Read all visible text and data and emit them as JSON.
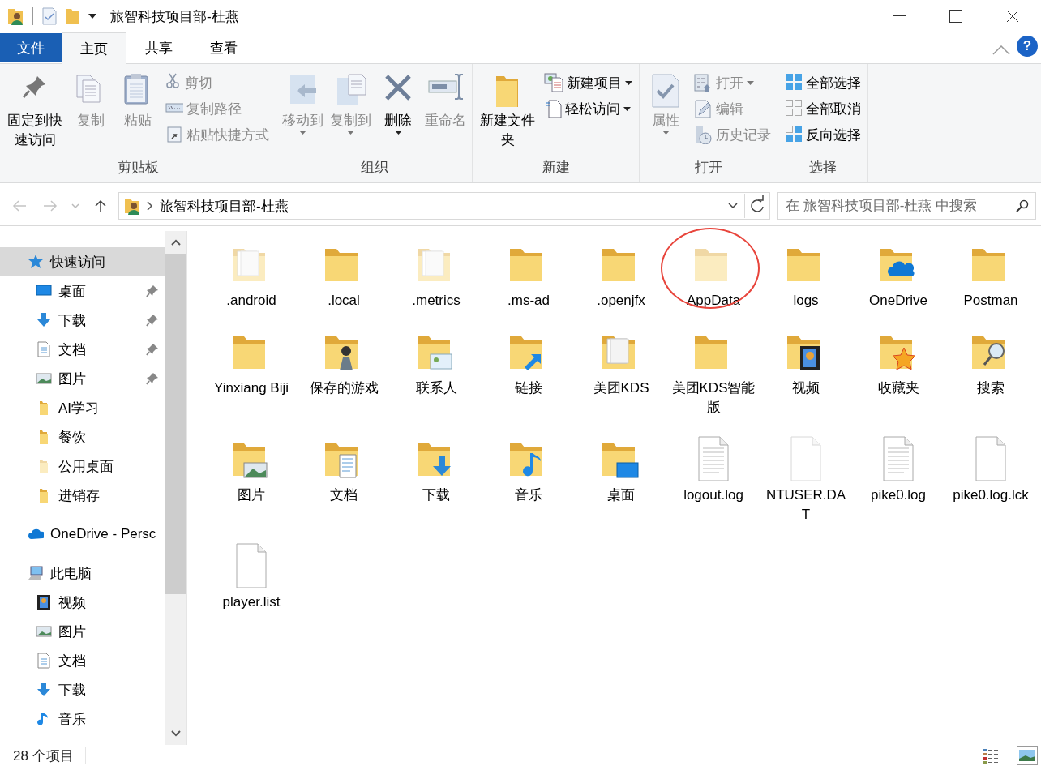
{
  "window": {
    "title": "旅智科技项目部-杜燕",
    "help": "?"
  },
  "ribbon_tabs": [
    {
      "label": "文件",
      "kind": "file",
      "selected": false
    },
    {
      "label": "主页",
      "kind": "tab",
      "selected": true
    },
    {
      "label": "共享",
      "kind": "tab",
      "selected": false
    },
    {
      "label": "查看",
      "kind": "tab",
      "selected": false
    }
  ],
  "ribbon_groups": [
    {
      "label": "剪贴板",
      "large": [
        {
          "label": "固定到快速访问",
          "kind": "pin",
          "disabled": false,
          "dropdown": false
        },
        {
          "label": "复制",
          "kind": "copy",
          "disabled": true,
          "dropdown": false
        },
        {
          "label": "粘贴",
          "kind": "paste",
          "disabled": true,
          "dropdown": false
        }
      ],
      "small": [
        {
          "label": "剪切",
          "kind": "cut",
          "disabled": true,
          "dropdown": false
        },
        {
          "label": "复制路径",
          "kind": "path",
          "disabled": true,
          "dropdown": false
        },
        {
          "label": "粘贴快捷方式",
          "kind": "shortcut",
          "disabled": true,
          "dropdown": false
        }
      ]
    },
    {
      "label": "组织",
      "large": [
        {
          "label": "移动到",
          "kind": "move",
          "disabled": true,
          "dropdown": true
        },
        {
          "label": "复制到",
          "kind": "copyto",
          "disabled": true,
          "dropdown": true
        },
        {
          "label": "删除",
          "kind": "delete",
          "disabled": false,
          "dropdown": true
        },
        {
          "label": "重命名",
          "kind": "rename",
          "disabled": true,
          "dropdown": false
        }
      ]
    },
    {
      "label": "新建",
      "large": [
        {
          "label": "新建文件夹",
          "kind": "newfolder",
          "disabled": false,
          "dropdown": false
        }
      ],
      "small": [
        {
          "label": "新建项目",
          "kind": "newitem",
          "disabled": false,
          "dropdown": true
        },
        {
          "label": "轻松访问",
          "kind": "easy",
          "disabled": false,
          "dropdown": true
        }
      ]
    },
    {
      "label": "打开",
      "large": [
        {
          "label": "属性",
          "kind": "properties",
          "disabled": true,
          "dropdown": true
        }
      ],
      "small": [
        {
          "label": "打开",
          "kind": "open",
          "disabled": true,
          "dropdown": true
        },
        {
          "label": "编辑",
          "kind": "edit",
          "disabled": true,
          "dropdown": false
        },
        {
          "label": "历史记录",
          "kind": "history",
          "disabled": true,
          "dropdown": false
        }
      ]
    },
    {
      "label": "选择",
      "small": [
        {
          "label": "全部选择",
          "kind": "selectall",
          "disabled": false,
          "dropdown": false
        },
        {
          "label": "全部取消",
          "kind": "selectnone",
          "disabled": false,
          "dropdown": false
        },
        {
          "label": "反向选择",
          "kind": "invert",
          "disabled": false,
          "dropdown": false
        }
      ]
    }
  ],
  "navigation": {
    "back": {
      "disabled": true
    },
    "forward": {
      "disabled": true
    }
  },
  "address": {
    "path": "旅智科技项目部-杜燕"
  },
  "search": {
    "placeholder": "在 旅智科技项目部-杜燕 中搜索"
  },
  "sidebar": {
    "items": [
      {
        "label": "快速访问",
        "kind": "star",
        "selected": true,
        "children": [
          {
            "label": "桌面",
            "kind": "desktop",
            "pinned": true,
            "selected": false
          },
          {
            "label": "下载",
            "kind": "downloads",
            "pinned": true,
            "selected": false
          },
          {
            "label": "文档",
            "kind": "documents",
            "pinned": true,
            "selected": false
          },
          {
            "label": "图片",
            "kind": "pictures",
            "pinned": true,
            "selected": false
          },
          {
            "label": "AI学习",
            "kind": "folder",
            "pinned": false,
            "selected": false
          },
          {
            "label": "餐饮",
            "kind": "folder",
            "pinned": false,
            "selected": false
          },
          {
            "label": "公用桌面",
            "kind": "folder",
            "pinned": false,
            "hidden": true,
            "selected": false
          },
          {
            "label": "进销存",
            "kind": "folder",
            "pinned": false,
            "selected": false
          }
        ]
      },
      {
        "label": "OneDrive - Persc",
        "kind": "cloud",
        "selected": false
      },
      {
        "label": "此电脑",
        "kind": "pc",
        "selected": false,
        "children": [
          {
            "label": "视频",
            "kind": "videos",
            "pinned": false,
            "selected": false
          },
          {
            "label": "图片",
            "kind": "pictures",
            "pinned": false,
            "selected": false
          },
          {
            "label": "文档",
            "kind": "documents",
            "pinned": false,
            "selected": false
          },
          {
            "label": "下载",
            "kind": "downloads",
            "pinned": false,
            "selected": false
          },
          {
            "label": "音乐",
            "kind": "music",
            "pinned": false,
            "selected": false
          }
        ]
      }
    ]
  },
  "files": [
    {
      "name": ".android",
      "kind": "papers",
      "hidden": true
    },
    {
      "name": ".local",
      "kind": "folder",
      "hidden": false
    },
    {
      "name": ".metrics",
      "kind": "papers",
      "hidden": true
    },
    {
      "name": ".ms-ad",
      "kind": "plain",
      "hidden": false
    },
    {
      "name": ".openjfx",
      "kind": "folder",
      "hidden": false
    },
    {
      "name": "AppData",
      "kind": "folder",
      "hidden": true,
      "circled": true
    },
    {
      "name": "logs",
      "kind": "folder",
      "hidden": false
    },
    {
      "name": "OneDrive",
      "kind": "onedrive",
      "hidden": false
    },
    {
      "name": "Postman",
      "kind": "folder",
      "hidden": false
    },
    {
      "name": "Yinxiang Biji",
      "kind": "folder",
      "hidden": false
    },
    {
      "name": "保存的游戏",
      "kind": "games",
      "hidden": false
    },
    {
      "name": "联系人",
      "kind": "contacts",
      "hidden": false
    },
    {
      "name": "链接",
      "kind": "links",
      "hidden": false
    },
    {
      "name": "美团KDS",
      "kind": "papers",
      "hidden": false
    },
    {
      "name": "美团KDS智能版",
      "kind": "folder",
      "hidden": false
    },
    {
      "name": "视频",
      "kind": "videos",
      "hidden": false
    },
    {
      "name": "收藏夹",
      "kind": "favorites",
      "hidden": false
    },
    {
      "name": "搜索",
      "kind": "searches",
      "hidden": false
    },
    {
      "name": "图片",
      "kind": "pictures",
      "hidden": false
    },
    {
      "name": "文档",
      "kind": "documents",
      "hidden": false
    },
    {
      "name": "下载",
      "kind": "downloads",
      "hidden": false
    },
    {
      "name": "音乐",
      "kind": "music",
      "hidden": false
    },
    {
      "name": "桌面",
      "kind": "desktop",
      "hidden": false
    },
    {
      "name": "logout.log",
      "kind": "textfile",
      "hidden": false
    },
    {
      "name": "NTUSER.DAT",
      "kind": "blankfile",
      "hidden": true
    },
    {
      "name": "pike0.log",
      "kind": "textfile",
      "hidden": false
    },
    {
      "name": "pike0.log.lck",
      "kind": "blankfile",
      "hidden": false
    },
    {
      "name": "player.list",
      "kind": "blankfile",
      "hidden": false
    }
  ],
  "status_bar": {
    "count": "28 个项目",
    "views": [
      {
        "kind": "details",
        "selected": false
      },
      {
        "kind": "largeicons",
        "selected": true
      }
    ]
  }
}
